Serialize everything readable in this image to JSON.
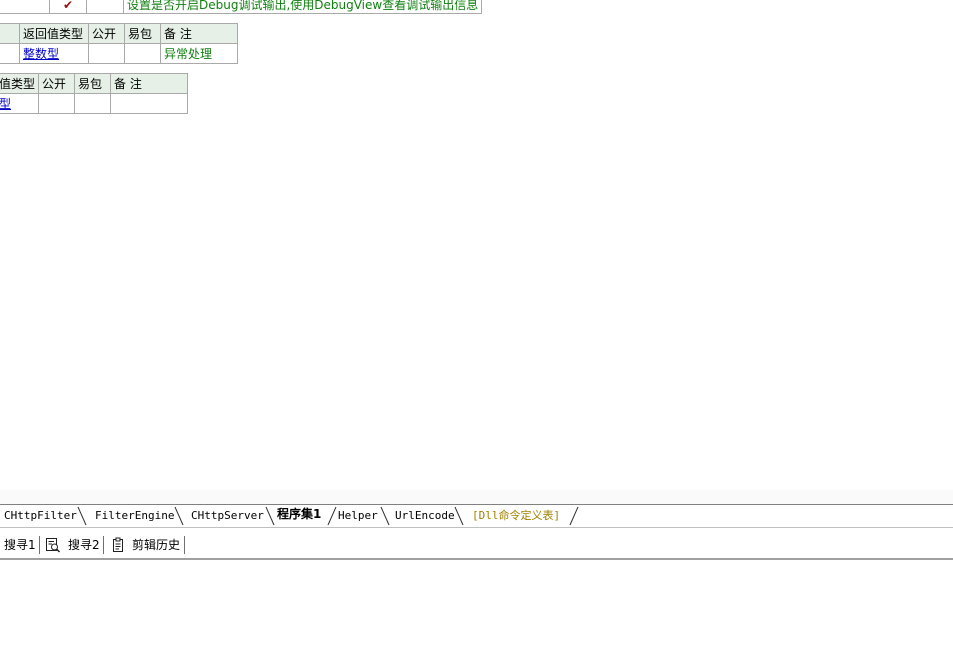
{
  "top_row": {
    "checked": "✔",
    "note": "设置是否开启Debug调试输出,使用DebugView查看调试输出信息"
  },
  "table2": {
    "headers": [
      "返回值类型",
      "公开",
      "易包",
      "备 注"
    ],
    "row": {
      "type": "整数型",
      "public": "",
      "easy": "",
      "note": "异常处理"
    }
  },
  "table3": {
    "headers": [
      "值类型",
      "公开",
      "易包",
      "备 注"
    ],
    "row": {
      "type": "型",
      "public": "",
      "easy": "",
      "note": ""
    }
  },
  "tabs": [
    {
      "label": "CHttpFilter",
      "active": false
    },
    {
      "label": "FilterEngine",
      "active": false
    },
    {
      "label": "CHttpServer",
      "active": false
    },
    {
      "label": "程序集1",
      "active": true
    },
    {
      "label": "Helper",
      "active": false
    },
    {
      "label": "UrlEncode",
      "active": false
    },
    {
      "label": "[Dll命令定义表]",
      "active": false
    }
  ],
  "toolbar": {
    "search1": "搜寻1",
    "search2": "搜寻2",
    "clip_history": "剪辑历史"
  },
  "colors": {
    "header_bg": "#e6f0e6",
    "note_green": "#108010",
    "link_blue": "#0000c8",
    "check_red": "#9a1010",
    "dll_tab": "#a08000"
  }
}
